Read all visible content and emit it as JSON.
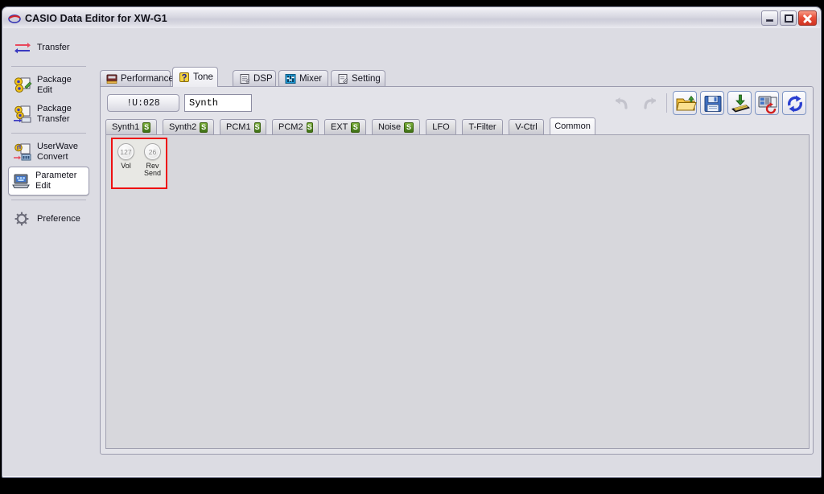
{
  "window": {
    "title": "CASIO Data Editor for XW-G1",
    "app_icon": "casio-logo-icon",
    "controls": {
      "minimize": "minimize-button",
      "maximize": "maximize-button",
      "close": "close-button"
    }
  },
  "sidebar": {
    "items": [
      {
        "label": "Transfer",
        "icon": "transfer-arrows-icon",
        "selected": false
      },
      {
        "label": "Package\nEdit",
        "icon": "package-edit-icon",
        "selected": false
      },
      {
        "label": "Package\nTransfer",
        "icon": "package-transfer-icon",
        "selected": false
      },
      {
        "label": "UserWave\nConvert",
        "icon": "userwave-convert-icon",
        "selected": false
      },
      {
        "label": "Parameter\nEdit",
        "icon": "parameter-edit-icon",
        "selected": true
      },
      {
        "label": "Preference",
        "icon": "gear-icon",
        "selected": false
      }
    ]
  },
  "main": {
    "tabs": [
      {
        "label": "Performance",
        "icon": "performance-icon",
        "active": false
      },
      {
        "label": "Tone",
        "icon": "tone-icon",
        "active": true
      },
      {
        "label": "DSP",
        "icon": "dsp-icon",
        "active": false
      },
      {
        "label": "Mixer",
        "icon": "mixer-icon",
        "active": false
      },
      {
        "label": "Setting",
        "icon": "setting-icon",
        "active": false
      }
    ],
    "toolbar": {
      "tone_number": "!U:028",
      "tone_name_value": "Synth",
      "tone_name_placeholder": "Tone name",
      "buttons": [
        {
          "name": "undo-button",
          "icon": "undo-arrow-icon",
          "enabled": false
        },
        {
          "name": "redo-button",
          "icon": "redo-arrow-icon",
          "enabled": false
        },
        {
          "name": "open-file-button",
          "icon": "open-folder-icon",
          "enabled": true
        },
        {
          "name": "save-file-button",
          "icon": "floppy-save-icon",
          "enabled": true
        },
        {
          "name": "write-to-device-button",
          "icon": "chip-download-icon",
          "enabled": true
        },
        {
          "name": "device-restore-button",
          "icon": "device-undo-icon",
          "enabled": true
        },
        {
          "name": "sync-refresh-button",
          "icon": "refresh-sync-icon",
          "enabled": true
        }
      ]
    },
    "subtabs": [
      {
        "label": "Synth1",
        "badge": "S",
        "active": false
      },
      {
        "label": "Synth2",
        "badge": "S",
        "active": false
      },
      {
        "label": "PCM1",
        "badge": "S",
        "active": false
      },
      {
        "label": "PCM2",
        "badge": "S",
        "active": false
      },
      {
        "label": "EXT",
        "badge": "S",
        "active": false
      },
      {
        "label": "Noise",
        "badge": "S",
        "active": false
      },
      {
        "label": "LFO",
        "badge": "",
        "active": false
      },
      {
        "label": "T-Filter",
        "badge": "",
        "active": false
      },
      {
        "label": "V-Ctrl",
        "badge": "",
        "active": false
      },
      {
        "label": "Common",
        "badge": "",
        "active": true
      }
    ],
    "editor": {
      "group_border_color": "#ee1111",
      "knobs": [
        {
          "value": "127",
          "label": "Vol"
        },
        {
          "value": "26",
          "label": "Rev\nSend"
        }
      ]
    }
  }
}
